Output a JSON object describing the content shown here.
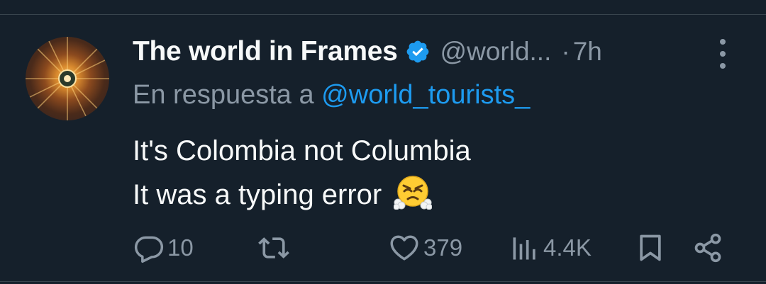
{
  "tweet": {
    "display_name": "The world in Frames",
    "handle": "@world...",
    "separator": "·",
    "time": "7h",
    "reply_prefix": "En respuesta a",
    "reply_mention": "@world_tourists_",
    "body_line1": "It's Colombia not Columbia",
    "body_line2": "It was a typing error",
    "emoji": "face-with-steam-from-nose"
  },
  "actions": {
    "replies": "10",
    "retweets": "",
    "likes": "379",
    "views": "4.4K"
  },
  "colors": {
    "background": "#15202b",
    "text": "#f7f9f9",
    "muted": "#8b98a5",
    "accent": "#1d9bf0",
    "divider": "#38444d"
  },
  "icons": [
    "verified-badge-icon",
    "more-options-icon",
    "reply-icon",
    "retweet-icon",
    "like-icon",
    "views-icon",
    "bookmark-icon",
    "share-icon"
  ]
}
